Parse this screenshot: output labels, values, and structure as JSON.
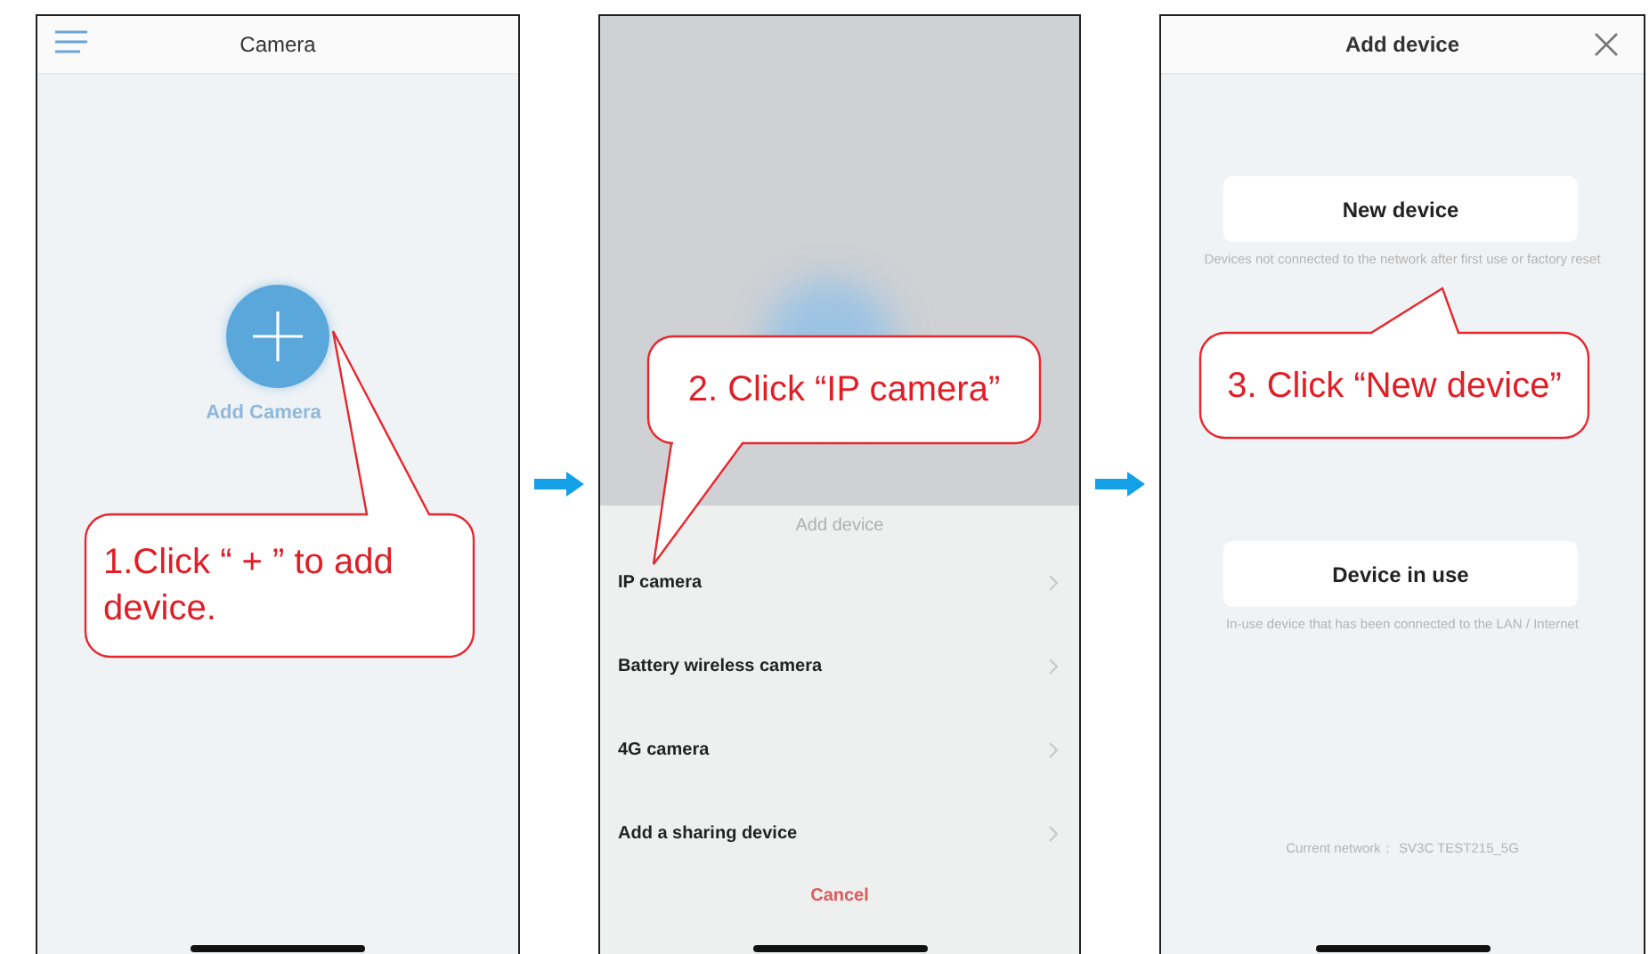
{
  "steps": [
    {
      "kind": "home",
      "header": {
        "title": "Camera"
      },
      "add_label": "Add Camera",
      "callout": "1.Click “ + ” to add device."
    },
    {
      "kind": "sheet",
      "sheet": {
        "title": "Add device",
        "items": [
          "IP camera",
          "Battery wireless camera",
          "4G camera",
          "Add a sharing device"
        ],
        "cancel": "Cancel"
      },
      "callout": "2. Click “IP camera”"
    },
    {
      "kind": "options",
      "header": {
        "title": "Add device"
      },
      "options": [
        {
          "label": "New device",
          "caption": "Devices not connected to the network after first use or factory reset"
        },
        {
          "label": "Device in use",
          "caption": "In-use device that has been connected to the LAN / Internet"
        }
      ],
      "network": "Current network： SV3C TEST215_5G",
      "callout": "3. Click “New device”"
    }
  ]
}
